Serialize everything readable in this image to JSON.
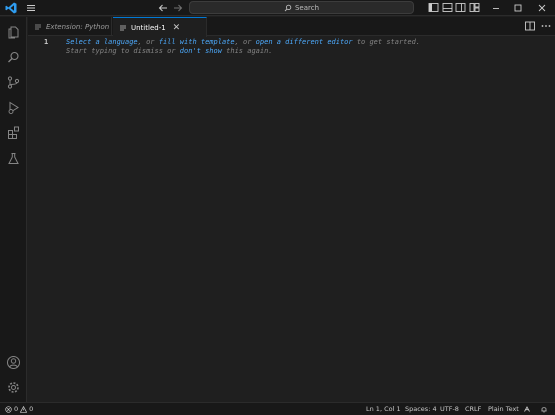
{
  "titlebar": {
    "search_label": "Search"
  },
  "tabs": [
    {
      "label": "Extension: Python"
    },
    {
      "label": "Untitled-1",
      "active": true
    }
  ],
  "editor": {
    "line_number": "1",
    "hint_line1": {
      "link1": "Select a language",
      "sep1": ", or ",
      "link2": "fill with template",
      "sep2": ", or ",
      "link3": "open a different editor",
      "tail": " to get started."
    },
    "hint_line2": {
      "head": "Start typing to dismiss or ",
      "link": "don't show",
      "tail": " this again."
    }
  },
  "statusbar": {
    "errors": "0",
    "warnings": "0",
    "position": "Ln 1, Col 1",
    "spaces": "Spaces: 4",
    "encoding": "UTF-8",
    "eol": "CRLF",
    "language": "Plain Text"
  },
  "colors": {
    "accent": "#0078d4",
    "link": "#4daafc",
    "vscode_logo": "#2f9df0",
    "background": "#1f1f1f",
    "chrome": "#181818"
  },
  "icons": {
    "activity_bar": [
      "files-icon",
      "search-icon",
      "source-control-icon",
      "run-debug-icon",
      "extensions-icon",
      "testing-icon"
    ],
    "activity_bar_bottom": [
      "accounts-icon",
      "manage-gear-icon"
    ]
  }
}
